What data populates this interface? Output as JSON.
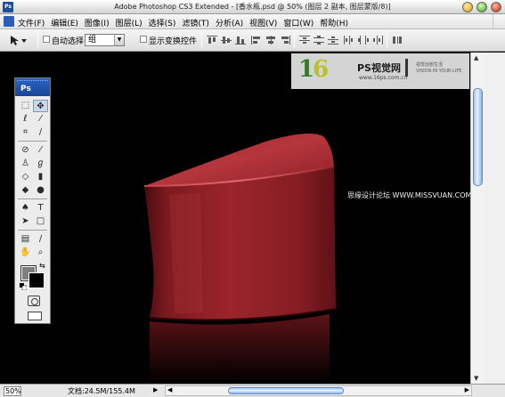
{
  "window": {
    "app_icon": "Ps",
    "title": "Adobe Photoshop CS3 Extended - [香水瓶.psd @ 50% (图层 2 副本, 图层蒙版/8)]"
  },
  "menu": {
    "items": [
      "文件(F)",
      "编辑(E)",
      "图像(I)",
      "图层(L)",
      "选择(S)",
      "滤镜(T)",
      "分析(A)",
      "视图(V)",
      "窗口(W)",
      "帮助(H)"
    ]
  },
  "options": {
    "auto_select_label": "自动选择:",
    "auto_select_value": "组",
    "show_transform_label": "显示变换控件",
    "auto_select_checked": false,
    "show_transform_checked": false
  },
  "toolbox": {
    "logo": "Ps",
    "foreground_color": "#7f7f7f",
    "background_color": "#000000"
  },
  "watermark": {
    "logo_digits_a": "1",
    "logo_digits_b": "6",
    "brand": "PS视觉网",
    "url": "www.16ps.com.cn",
    "slogan_line1": "视觉创想生活",
    "slogan_line2": "VISION IN YOUR LIFE"
  },
  "site_mark": "思缘设计论坛 WWW.MISSVUAN.COM",
  "status": {
    "zoom": "50%",
    "doc_info": "文档:24.5M/155.4M"
  },
  "colors": {
    "bottle_red": "#8b1c22",
    "canvas_bg": "#000000",
    "scroll_accent": "#8ab4e6",
    "toolbox_header": "#1a4596"
  }
}
